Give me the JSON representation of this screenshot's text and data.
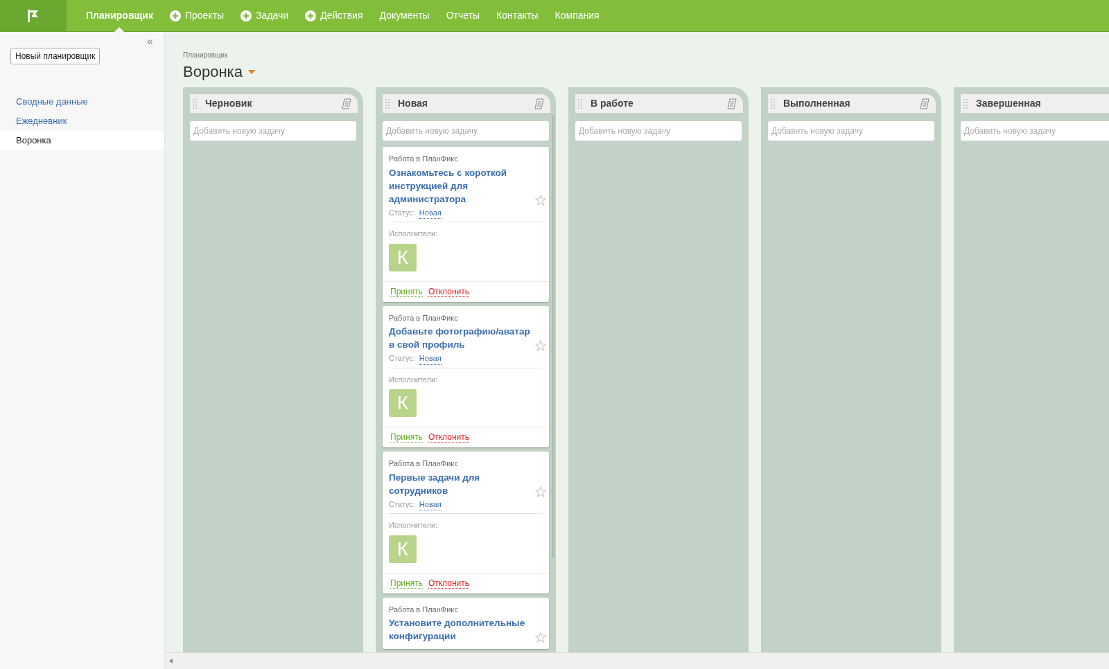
{
  "nav": [
    {
      "label": "Планировщик",
      "kind": "plain",
      "selected": true
    },
    {
      "label": "Проекты",
      "kind": "plus",
      "selected": false
    },
    {
      "label": "Задачи",
      "kind": "plus",
      "selected": false
    },
    {
      "label": "Действия",
      "kind": "plus",
      "selected": false
    },
    {
      "label": "Документы",
      "kind": "plain",
      "selected": false
    },
    {
      "label": "Отчеты",
      "kind": "plain",
      "selected": false
    },
    {
      "label": "Контакты",
      "kind": "plain",
      "selected": false
    },
    {
      "label": "Компания",
      "kind": "plain",
      "selected": false
    }
  ],
  "sidebar": {
    "collapse": "«",
    "new_button": "Новый планировщик",
    "items": [
      {
        "label": "Сводные данные",
        "selected": false
      },
      {
        "label": "Ежедневник",
        "selected": false
      },
      {
        "label": "Воронка",
        "selected": true
      }
    ]
  },
  "header": {
    "breadcrumb": "Планировщик",
    "title": "Воронка"
  },
  "columns": [
    {
      "title": "Черновик",
      "menu_icon": true,
      "placeholder": "Добавить новую задачу"
    },
    {
      "title": "Новая",
      "menu_icon": true,
      "placeholder": "Добавить новую задачу",
      "cards": [
        {
          "source": "Работа в ПланФикс",
          "title": "Ознакомьтесь с короткой инструкцией для администратора",
          "status_label": "Статус:",
          "status": "Новая",
          "assignees_label": "Исполнители:",
          "avatar": "К",
          "accept": "Принять",
          "decline": "Отклонить"
        },
        {
          "source": "Работа в ПланФикс",
          "title": "Добавьте фотографию/аватар в свой профиль",
          "status_label": "Статус:",
          "status": "Новая",
          "assignees_label": "Исполнители:",
          "avatar": "К",
          "accept": "Принять",
          "decline": "Отклонить"
        },
        {
          "source": "Работа в ПланФикс",
          "title": "Первые задачи для сотрудников",
          "status_label": "Статус:",
          "status": "Новая",
          "assignees_label": "Исполнители:",
          "avatar": "К",
          "accept": "Принять",
          "decline": "Отклонить"
        },
        {
          "source": "Работа в ПланФикс",
          "title": "Установите дополнительные конфигурации"
        }
      ]
    },
    {
      "title": "В работе",
      "menu_icon": true,
      "placeholder": "Добавить новую задачу"
    },
    {
      "title": "Выполненная",
      "menu_icon": true,
      "placeholder": "Добавить новую задачу"
    },
    {
      "title": "Завершенная",
      "placeholder": "Добавить новую задачу"
    }
  ]
}
